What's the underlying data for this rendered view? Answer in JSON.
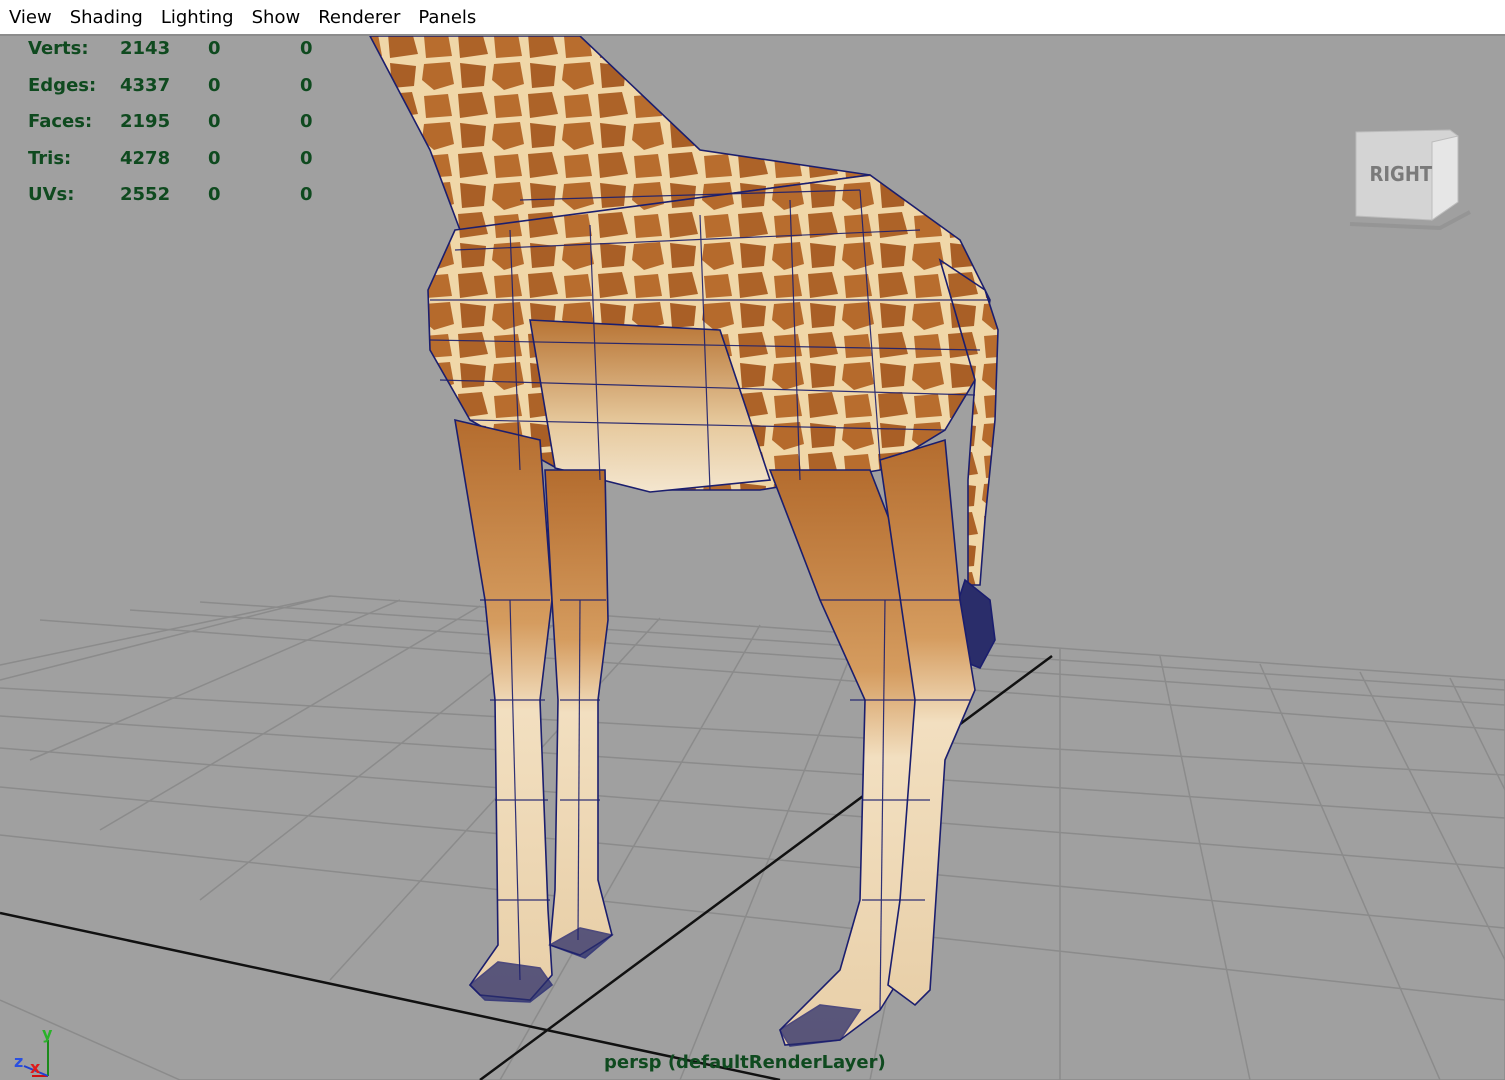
{
  "menubar": {
    "items": [
      "View",
      "Shading",
      "Lighting",
      "Show",
      "Renderer",
      "Panels"
    ]
  },
  "hud": {
    "rows": [
      {
        "label": "Verts:",
        "value": "2143",
        "selected": "0",
        "uv": "0"
      },
      {
        "label": "Edges:",
        "value": "4337",
        "selected": "0",
        "uv": "0"
      },
      {
        "label": "Faces:",
        "value": "2195",
        "selected": "0",
        "uv": "0"
      },
      {
        "label": "Tris:",
        "value": "4278",
        "selected": "0",
        "uv": "0"
      },
      {
        "label": "UVs:",
        "value": "2552",
        "selected": "0",
        "uv": "0"
      }
    ]
  },
  "viewcube": {
    "face_label": "RIGHT"
  },
  "camera_label": "persp (defaultRenderLayer)",
  "axis_gizmo": {
    "y": "y",
    "z": "z",
    "x": "x"
  },
  "colors": {
    "viewport_bg": "#a0a0a0",
    "grid": "#8a8a8a",
    "hud_text": "#0f4a1f",
    "wire": "#1b1e6e",
    "hide": "#b9702f",
    "leg_light": "#efd9b6"
  },
  "icons": {
    "view_cube": "view-cube-icon",
    "axis": "axis-gizmo-icon"
  }
}
